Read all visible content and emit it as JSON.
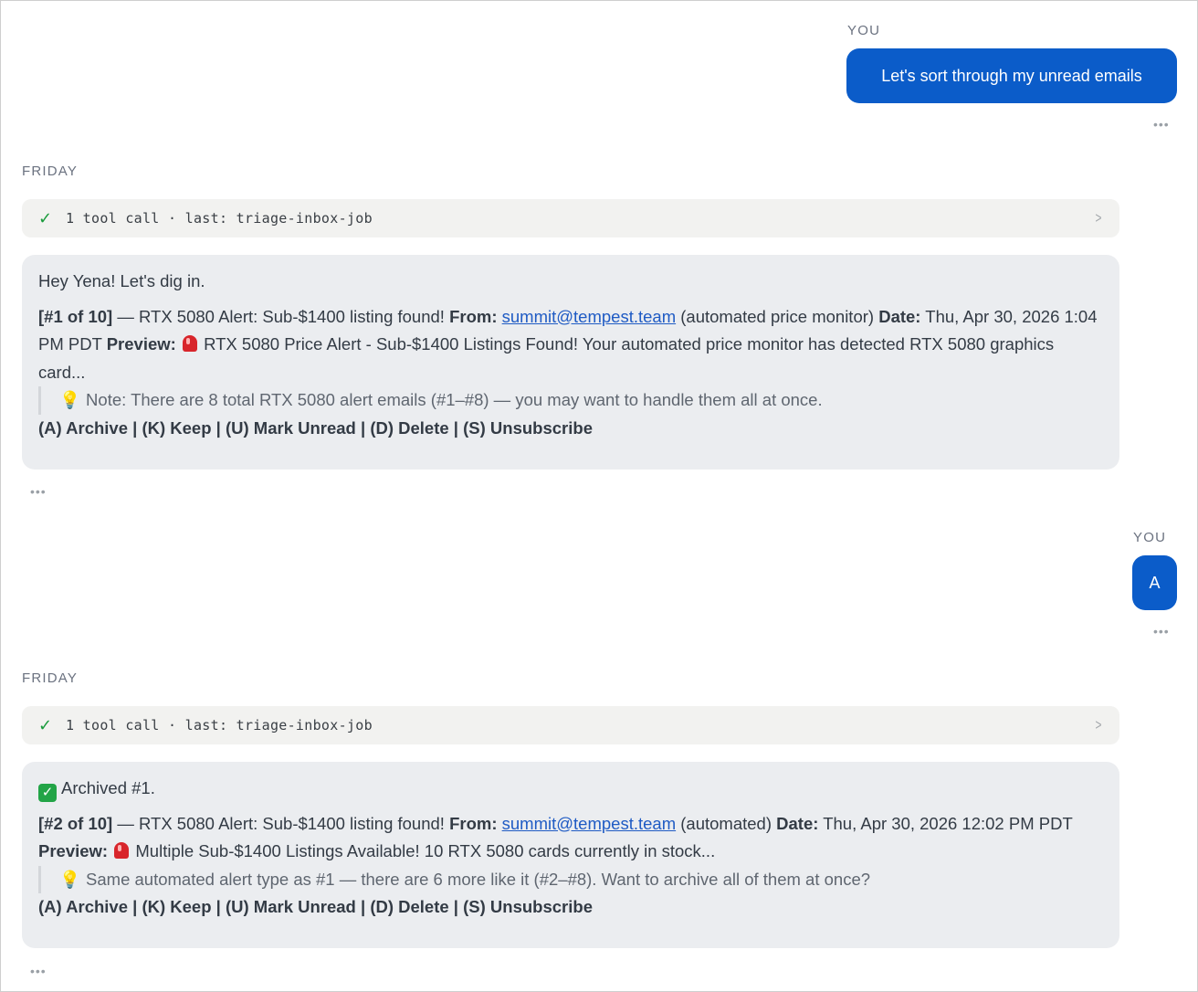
{
  "colors": {
    "user_bubble": "#0b5cc9",
    "tool_bar_bg": "#f2f2f0",
    "assistant_card_bg": "#ebedf0",
    "link": "#1f5bc4",
    "check_green": "#1a9b3c"
  },
  "thread": {
    "user_message_1": {
      "sender": "YOU",
      "text": "Let's sort through my unread emails",
      "more_icon": "ellipsis-icon"
    },
    "assistant_message_1": {
      "day": "FRIDAY",
      "tool_summary": {
        "check_icon": "checkmark-icon",
        "text": "1 tool call · last: triage-inbox-job",
        "chevron_icon": "chevron-right-icon"
      },
      "greeting": "Hey Yena! Let's dig in.",
      "email": {
        "index": "[#1 of 10]",
        "subject": " — RTX 5080 Alert: Sub-$1400 listing found! ",
        "from_label": "From:",
        "from_email": "summit@tempest.team",
        "from_note": " (automated price monitor) ",
        "date_label": "Date:",
        "date": " Thu, Apr 30, 2026 1:04 PM PDT ",
        "preview_label": "Preview:",
        "preview_icon": "siren-icon",
        "preview": " RTX 5080 Price Alert - Sub-$1400 Listings Found! Your automated price monitor has detected RTX 5080 graphics card..."
      },
      "note_icon": "lightbulb-icon",
      "note": "Note: There are 8 total RTX 5080 alert emails (#1–#8) — you may want to handle them all at once.",
      "actions": "(A) Archive | (K) Keep | (U) Mark Unread | (D) Delete | (S) Unsubscribe",
      "more_icon": "ellipsis-icon"
    },
    "user_message_2": {
      "sender": "YOU",
      "text": "A",
      "more_icon": "ellipsis-icon"
    },
    "assistant_message_2": {
      "day": "FRIDAY",
      "tool_summary": {
        "check_icon": "checkmark-icon",
        "text": "1 tool call · last: triage-inbox-job",
        "chevron_icon": "chevron-right-icon"
      },
      "status_icon": "check-box-icon",
      "status": "Archived #1.",
      "email": {
        "index": "[#2 of 10]",
        "subject": " — RTX 5080 Alert: Sub-$1400 listing found! ",
        "from_label": "From:",
        "from_email": "summit@tempest.team",
        "from_note": " (automated) ",
        "date_label": "Date:",
        "date": " Thu, Apr 30, 2026 12:02 PM PDT ",
        "preview_label": "Preview:",
        "preview_icon": "siren-icon",
        "preview": " Multiple Sub-$1400 Listings Available! 10 RTX 5080 cards currently in stock..."
      },
      "note_icon": "lightbulb-icon",
      "note": "Same automated alert type as #1 — there are 6 more like it (#2–#8). Want to archive all of them at once?",
      "actions": "(A) Archive | (K) Keep | (U) Mark Unread | (D) Delete | (S) Unsubscribe",
      "more_icon": "ellipsis-icon"
    }
  }
}
